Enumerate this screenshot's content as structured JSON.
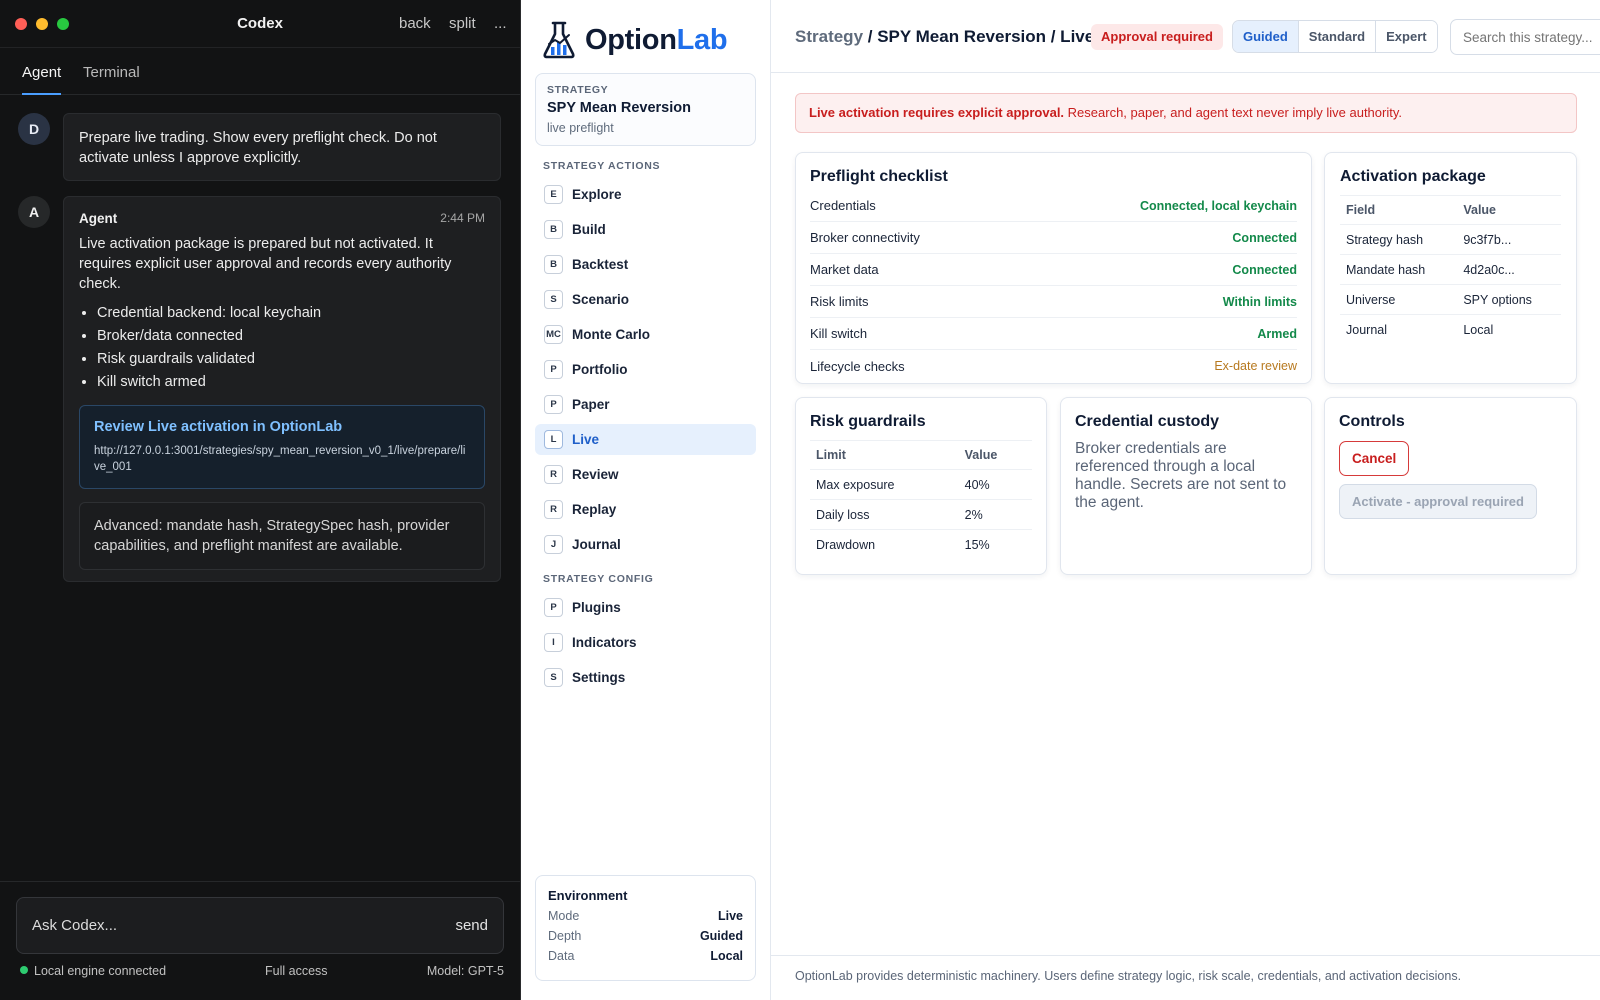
{
  "codex": {
    "title": "Codex",
    "window_actions": {
      "back": "back",
      "split": "split",
      "more": "..."
    },
    "tabs": [
      "Agent",
      "Terminal"
    ],
    "user_message": {
      "avatar": "D",
      "text": "Prepare live trading. Show every preflight check. Do not activate unless I approve explicitly."
    },
    "agent_message": {
      "avatar": "A",
      "name": "Agent",
      "time": "2:44 PM",
      "text": "Live activation package is prepared but not activated. It requires explicit user approval and records every authority check.",
      "bullets": [
        "Credential backend: local keychain",
        "Broker/data connected",
        "Risk guardrails validated",
        "Kill switch armed"
      ],
      "link": {
        "title": "Review Live activation in OptionLab",
        "url": "http://127.0.0.1:3001/strategies/spy_mean_reversion_v0_1/live/prepare/live_001"
      },
      "advanced": "Advanced: mandate hash, StrategySpec hash, provider capabilities, and preflight manifest are available."
    },
    "composer": {
      "placeholder": "Ask Codex...",
      "send": "send"
    },
    "status": {
      "engine": "Local engine connected",
      "access": "Full access",
      "model": "Model: GPT-5",
      "engine_color": "#2ecc71"
    }
  },
  "sidebar": {
    "logo": {
      "part1": "Option",
      "part2": "Lab",
      "accent": "#1f6feb"
    },
    "strategy": {
      "kicker": "STRATEGY",
      "name": "SPY Mean Reversion",
      "sub": "live preflight"
    },
    "actions_heading": "STRATEGY ACTIONS",
    "actions": [
      {
        "key": "E",
        "label": "Explore"
      },
      {
        "key": "B",
        "label": "Build"
      },
      {
        "key": "B",
        "label": "Backtest"
      },
      {
        "key": "S",
        "label": "Scenario"
      },
      {
        "key": "MC",
        "label": "Monte Carlo"
      },
      {
        "key": "P",
        "label": "Portfolio"
      },
      {
        "key": "P",
        "label": "Paper"
      },
      {
        "key": "L",
        "label": "Live"
      },
      {
        "key": "R",
        "label": "Review"
      },
      {
        "key": "R",
        "label": "Replay"
      },
      {
        "key": "J",
        "label": "Journal"
      }
    ],
    "config_heading": "STRATEGY CONFIG",
    "config": [
      {
        "key": "P",
        "label": "Plugins"
      },
      {
        "key": "I",
        "label": "Indicators"
      },
      {
        "key": "S",
        "label": "Settings"
      }
    ],
    "environment": {
      "title": "Environment",
      "rows": [
        {
          "k": "Mode",
          "v": "Live"
        },
        {
          "k": "Depth",
          "v": "Guided"
        },
        {
          "k": "Data",
          "v": "Local"
        }
      ]
    }
  },
  "main": {
    "breadcrumb": {
      "root": "Strategy",
      "rest": " / SPY Mean Reversion / Live"
    },
    "badge": "Approval required",
    "depth_modes": [
      "Guided",
      "Standard",
      "Expert"
    ],
    "active_depth": "Guided",
    "search_placeholder": "Search this strategy...",
    "alert": {
      "strong": "Live activation requires explicit approval.",
      "text": " Research, paper, and agent text never imply live authority."
    },
    "preflight": {
      "title": "Preflight checklist",
      "rows": [
        {
          "label": "Credentials",
          "status": "Connected, local keychain",
          "level": "ok"
        },
        {
          "label": "Broker connectivity",
          "status": "Connected",
          "level": "ok"
        },
        {
          "label": "Market data",
          "status": "Connected",
          "level": "ok"
        },
        {
          "label": "Risk limits",
          "status": "Within limits",
          "level": "ok"
        },
        {
          "label": "Kill switch",
          "status": "Armed",
          "level": "ok"
        },
        {
          "label": "Lifecycle checks",
          "status": "Ex-date review",
          "level": "warn"
        }
      ]
    },
    "activation": {
      "title": "Activation package",
      "headers": [
        "Field",
        "Value"
      ],
      "rows": [
        [
          "Strategy hash",
          "9c3f7b..."
        ],
        [
          "Mandate hash",
          "4d2a0c..."
        ],
        [
          "Universe",
          "SPY options"
        ],
        [
          "Journal",
          "Local"
        ]
      ]
    },
    "risk": {
      "title": "Risk guardrails",
      "headers": [
        "Limit",
        "Value"
      ],
      "rows": [
        [
          "Max exposure",
          "40%"
        ],
        [
          "Daily loss",
          "2%"
        ],
        [
          "Drawdown",
          "15%"
        ]
      ]
    },
    "credential": {
      "title": "Credential custody",
      "text": "Broker credentials are referenced through a local handle. Secrets are not sent to the agent."
    },
    "controls": {
      "title": "Controls",
      "cancel": "Cancel",
      "activate": "Activate - approval required"
    },
    "footer": "OptionLab provides deterministic machinery. Users define strategy logic, risk scale, credentials, and activation decisions."
  }
}
